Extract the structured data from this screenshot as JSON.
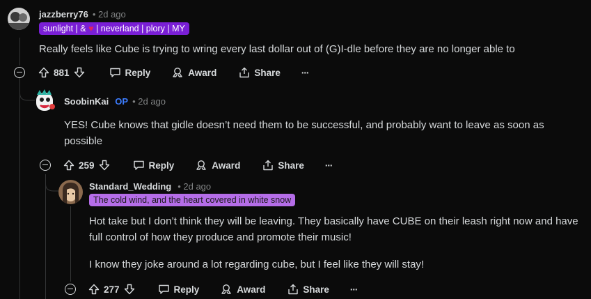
{
  "comments": [
    {
      "username": "jazzberry76",
      "time": "• 2d ago",
      "flair": "sunlight | & ♥ | neverland | plory | MY",
      "flair_color": "#7a1fd6",
      "body": [
        "Really feels like Cube is trying to wring every last dollar out of (G)I-dle before they are no longer able to"
      ],
      "votes": "881",
      "actions": {
        "reply": "Reply",
        "award": "Award",
        "share": "Share",
        "more": "···"
      }
    },
    {
      "username": "SoobinKai",
      "op": "OP",
      "time": "• 2d ago",
      "body": [
        "YES! Cube knows that gidle doesn’t need them to be successful, and probably want to leave as soon as possible"
      ],
      "votes": "259",
      "actions": {
        "reply": "Reply",
        "award": "Award",
        "share": "Share",
        "more": "···"
      }
    },
    {
      "username": "Standard_Wedding",
      "time": "• 2d ago",
      "flair": "The cold wind, and the heart covered in white snow",
      "flair_color": "#b56de8",
      "body": [
        "Hot take but I don’t think they will be leaving. They basically have CUBE on their leash right now and have full control of how they produce and promote their music!",
        "I know they joke around a lot regarding cube, but I feel like they will stay!"
      ],
      "votes": "277",
      "actions": {
        "reply": "Reply",
        "award": "Award",
        "share": "Share",
        "more": "···"
      }
    }
  ]
}
